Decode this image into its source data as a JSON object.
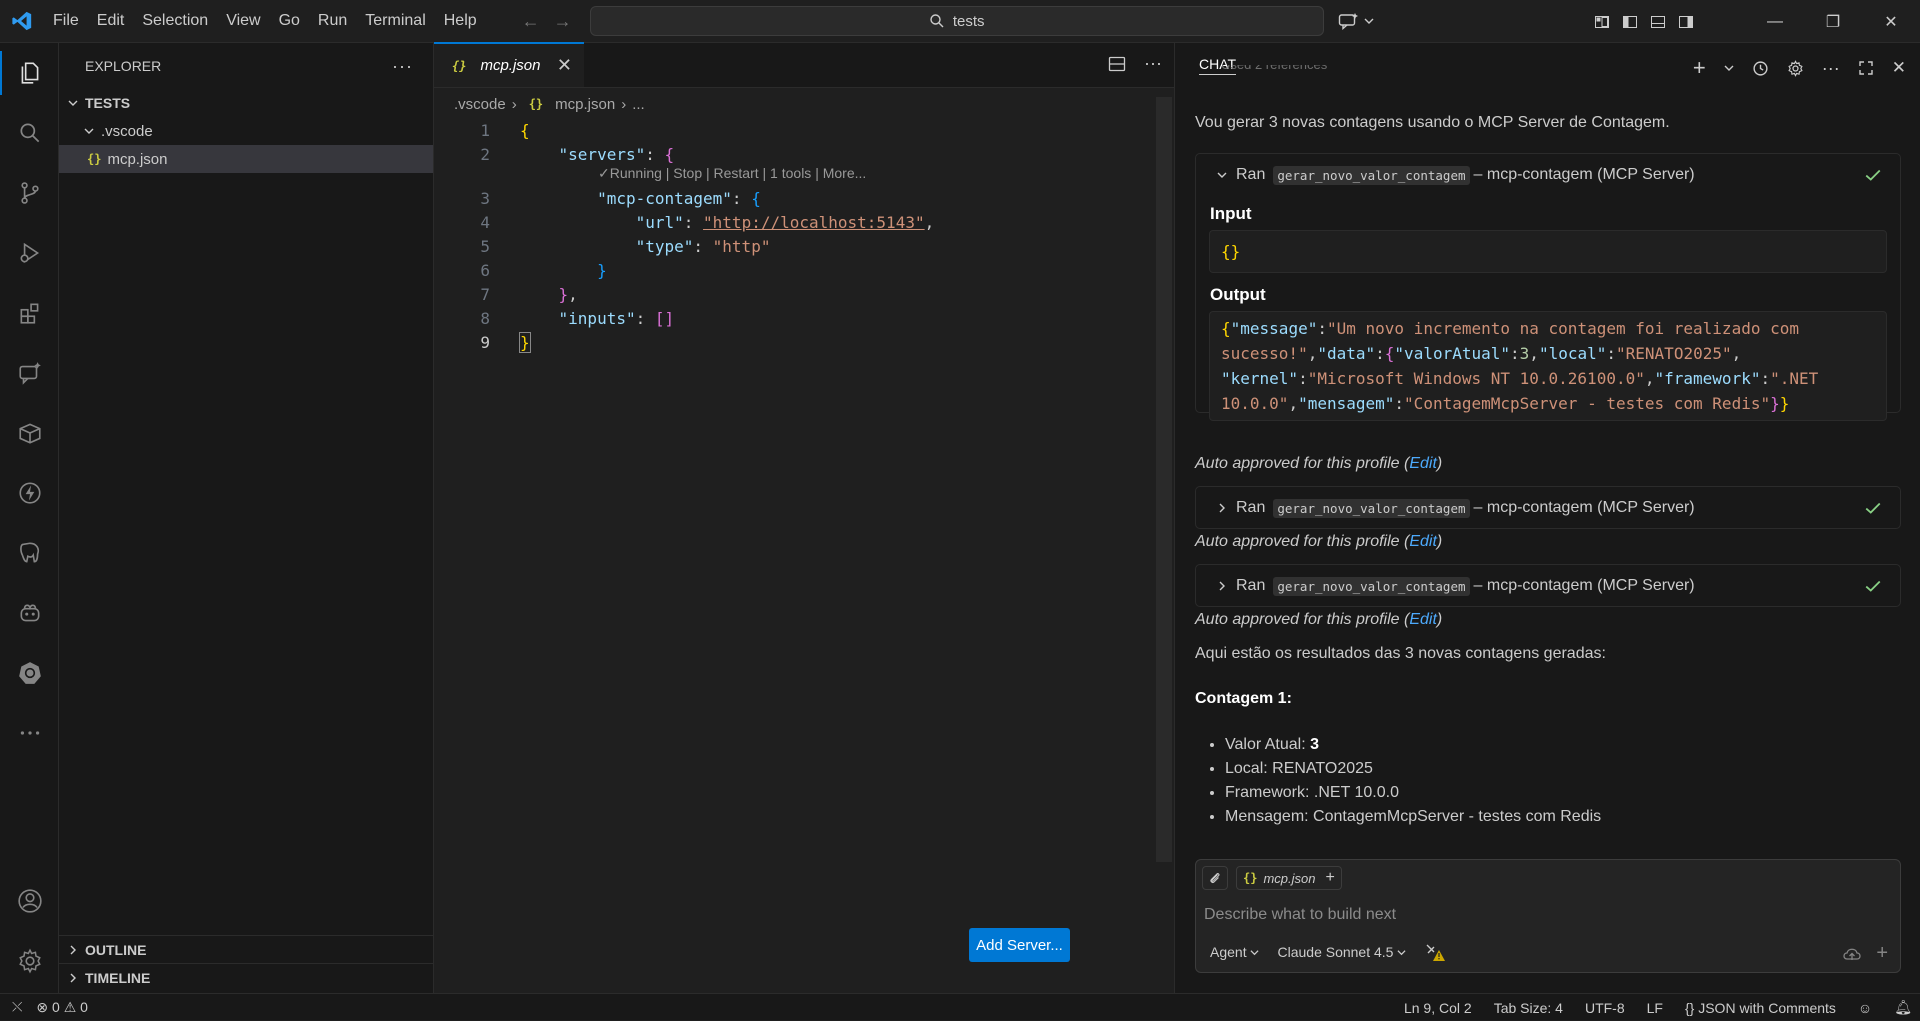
{
  "titlebar": {
    "menus": [
      "File",
      "Edit",
      "Selection",
      "View",
      "Go",
      "Run",
      "Terminal",
      "Help"
    ],
    "search_text": "tests"
  },
  "sidebar": {
    "title": "EXPLORER",
    "root": "TESTS",
    "folder": ".vscode",
    "file": "mcp.json",
    "outline": "OUTLINE",
    "timeline": "TIMELINE"
  },
  "editor": {
    "tab_label": "mcp.json",
    "breadcrumb": [
      ".vscode",
      "mcp.json",
      "..."
    ],
    "codelens": "Running | Stop | Restart | 1 tools | More...",
    "lines": {
      "l2_key": "\"servers\"",
      "l3_key": "\"mcp-contagem\"",
      "l4_key": "\"url\"",
      "l4_val": "\"http://localhost:5143\"",
      "l5_key": "\"type\"",
      "l5_val": "\"http\"",
      "l8_key": "\"inputs\""
    },
    "add_server_label": "Add Server..."
  },
  "chat": {
    "title": "CHAT",
    "truncated_line": "Used 2 references",
    "intro": "Vou gerar 3 novas contagens usando o MCP Server de Contagem.",
    "tools": [
      {
        "ran": "Ran",
        "name": "gerar_novo_valor_contagem",
        "server": "– mcp-contagem (MCP Server)"
      },
      {
        "ran": "Ran",
        "name": "gerar_novo_valor_contagem",
        "server": "– mcp-contagem (MCP Server)"
      },
      {
        "ran": "Ran",
        "name": "gerar_novo_valor_contagem",
        "server": "– mcp-contagem (MCP Server)"
      }
    ],
    "input_label": "Input",
    "input_value": "{}",
    "output_label": "Output",
    "output_json": {
      "message_key": "\"message\"",
      "message_val": "\"Um novo incremento na contagem foi realizado com sucesso!\"",
      "data_key": "\"data\"",
      "valor_key": "\"valorAtual\"",
      "valor_val": "3",
      "local_key": "\"local\"",
      "local_val": "\"RENATO2025\"",
      "kernel_key": "\"kernel\"",
      "kernel_val": "\"Microsoft Windows NT 10.0.26100.0\"",
      "framework_key": "\"framework\"",
      "framework_val": "\".NET 10.0.0\"",
      "mensagem_key": "\"mensagem\"",
      "mensagem_val": "\"ContagemMcpServer - testes com Redis\""
    },
    "approved_text": "Auto approved for this profile (",
    "approved_link": "Edit",
    "approved_close": ")",
    "summary": "Aqui estão os resultados das 3 novas contagens geradas:",
    "heading": "Contagem 1:",
    "results": [
      {
        "label": "Valor Atual: ",
        "value": "3",
        "bold": true
      },
      {
        "label": "Local: RENATO2025"
      },
      {
        "label": "Framework: .NET 10.0.0"
      },
      {
        "label": "Mensagem: ContagemMcpServer - testes com Redis"
      }
    ],
    "input_box": {
      "context_file": "mcp.json",
      "placeholder": "Describe what to build next",
      "mode": "Agent",
      "model": "Claude Sonnet 4.5"
    }
  },
  "statusbar": {
    "errors": "0",
    "warnings": "0",
    "position": "Ln 9, Col 2",
    "tab_size": "Tab Size: 4",
    "encoding": "UTF-8",
    "eol": "LF",
    "language": "JSON with Comments"
  },
  "colors": {
    "accent": "#0078d4",
    "check": "#89d185"
  }
}
